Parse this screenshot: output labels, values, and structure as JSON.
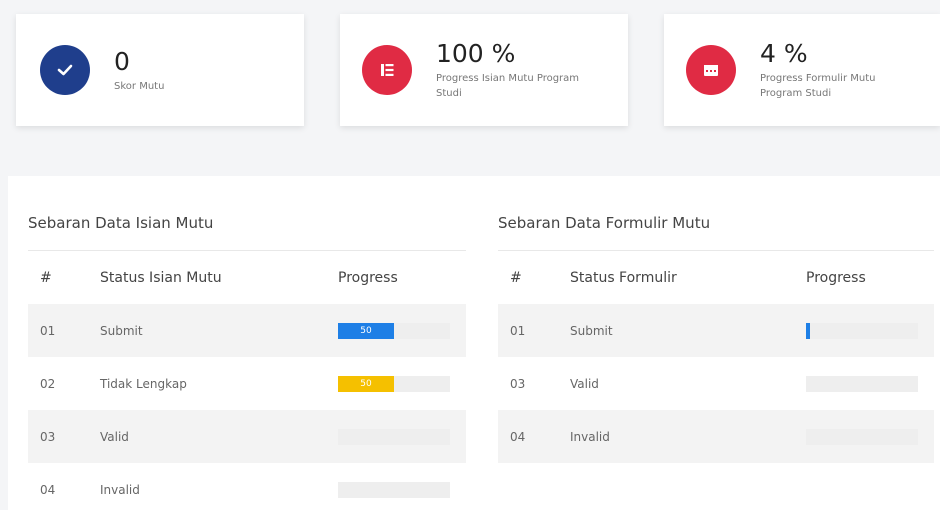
{
  "colors": {
    "navy": "#1f3e8c",
    "red": "#e02b44",
    "blue": "#1e7fe6",
    "yellow": "#f5c000"
  },
  "stats": [
    {
      "value": "0",
      "label": "Skor Mutu",
      "icon": "check-icon",
      "color": "#1f3e8c"
    },
    {
      "value": "100 %",
      "label": "Progress Isian Mutu Program Studi",
      "icon": "list-icon",
      "color": "#e02b44"
    },
    {
      "value": "4 %",
      "label": "Progress Formulir Mutu Program Studi",
      "icon": "calendar-icon",
      "color": "#e02b44"
    }
  ],
  "isian": {
    "title": "Sebaran Data Isian Mutu",
    "headers": [
      "#",
      "Status Isian Mutu",
      "Progress"
    ],
    "rows": [
      {
        "num": "01",
        "status": "Submit",
        "progress": 50,
        "label": "50",
        "color": "#1e7fe6"
      },
      {
        "num": "02",
        "status": "Tidak Lengkap",
        "progress": 50,
        "label": "50",
        "color": "#f5c000"
      },
      {
        "num": "03",
        "status": "Valid",
        "progress": 0,
        "label": "",
        "color": "#1e7fe6"
      },
      {
        "num": "04",
        "status": "Invalid",
        "progress": 0,
        "label": "",
        "color": "#1e7fe6"
      }
    ]
  },
  "formulir": {
    "title": "Sebaran Data Formulir Mutu",
    "headers": [
      "#",
      "Status Formulir",
      "Progress"
    ],
    "rows": [
      {
        "num": "01",
        "status": "Submit",
        "progress": 4,
        "label": "",
        "color": "#1e7fe6"
      },
      {
        "num": "03",
        "status": "Valid",
        "progress": 0,
        "label": "",
        "color": "#1e7fe6"
      },
      {
        "num": "04",
        "status": "Invalid",
        "progress": 0,
        "label": "",
        "color": "#1e7fe6"
      }
    ]
  }
}
